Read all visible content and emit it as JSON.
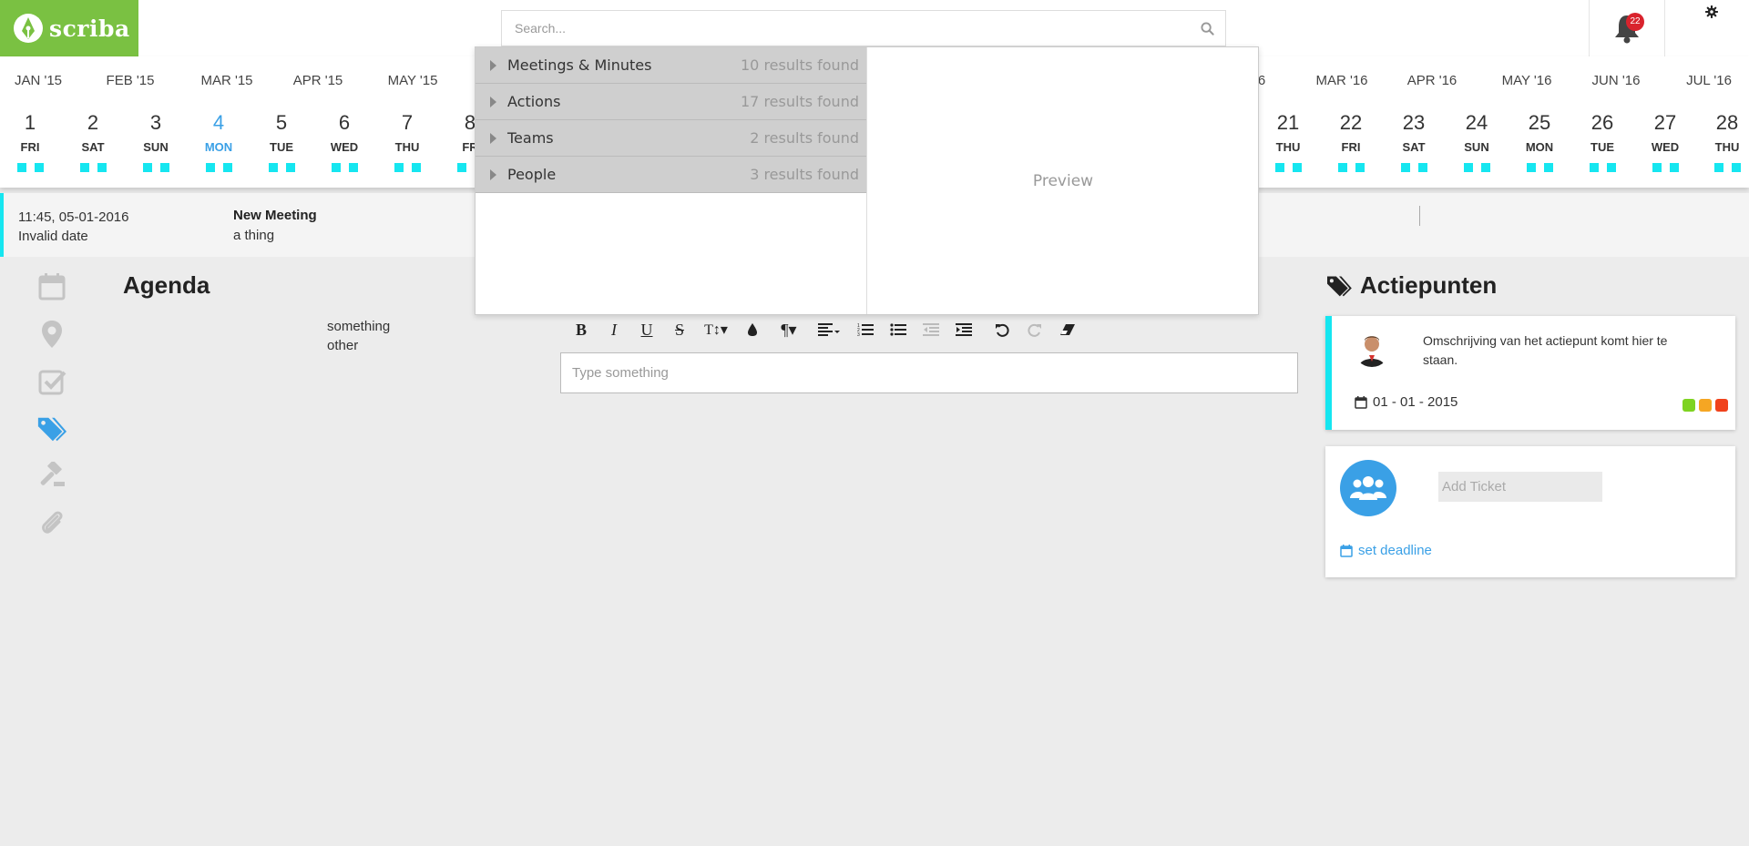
{
  "app": {
    "name": "scriba",
    "notification_count": "22"
  },
  "search": {
    "placeholder": "Search..."
  },
  "timeline": {
    "months": [
      "JAN '15",
      "FEB '15",
      "MAR '15",
      "APR '15",
      "MAY '15",
      "MAR '16",
      "APR '16",
      "MAY '16",
      "JUN '16",
      "JUL '16"
    ],
    "months_partial": [
      "6"
    ],
    "days_left": [
      {
        "num": "1",
        "wd": "FRI"
      },
      {
        "num": "2",
        "wd": "SAT"
      },
      {
        "num": "3",
        "wd": "SUN"
      },
      {
        "num": "4",
        "wd": "MON",
        "active": true
      },
      {
        "num": "5",
        "wd": "TUE"
      },
      {
        "num": "6",
        "wd": "WED"
      },
      {
        "num": "7",
        "wd": "THU"
      },
      {
        "num": "8",
        "wd": "FR"
      }
    ],
    "days_right": [
      {
        "num": "21",
        "wd": "THU"
      },
      {
        "num": "22",
        "wd": "FRI"
      },
      {
        "num": "23",
        "wd": "SAT"
      },
      {
        "num": "24",
        "wd": "SUN"
      },
      {
        "num": "25",
        "wd": "MON"
      },
      {
        "num": "26",
        "wd": "TUE"
      },
      {
        "num": "27",
        "wd": "WED"
      },
      {
        "num": "28",
        "wd": "THU"
      }
    ],
    "accent_color": "#16e6f0",
    "active_color": "#3aa0e6"
  },
  "meeting": {
    "datetime": "11:45, 05-01-2016",
    "date_status": "Invalid date",
    "title": "New Meeting",
    "subtitle": "a thing"
  },
  "sidebar": {
    "icons": [
      "calendar-icon",
      "map-marker-icon",
      "check-square-icon",
      "tags-icon",
      "gavel-icon",
      "paperclip-icon"
    ],
    "active": "tags-icon"
  },
  "agenda": {
    "heading": "Agenda",
    "items": [
      "something",
      "other"
    ]
  },
  "editor": {
    "placeholder": "Type something",
    "toolbar": [
      "bold",
      "italic",
      "underline",
      "strikethrough",
      "font-size",
      "color",
      "paragraph",
      "align",
      "ordered-list",
      "unordered-list",
      "outdent",
      "indent",
      "undo",
      "redo",
      "eraser"
    ]
  },
  "actions": {
    "heading": "Actiepunten",
    "card": {
      "description": "Omschrijving van het actiepunt komt hier te staan.",
      "date": "01 - 01 - 2015",
      "priority_colors": [
        "#7ed321",
        "#f5a623",
        "#f0421c"
      ]
    },
    "new_ticket": {
      "placeholder": "Add Ticket",
      "deadline_label": "set deadline"
    }
  },
  "search_dropdown": {
    "results": [
      {
        "label": "Meetings & Minutes",
        "count": "10 results found"
      },
      {
        "label": "Actions",
        "count": "17 results found"
      },
      {
        "label": "Teams",
        "count": "2 results found"
      },
      {
        "label": "People",
        "count": "3 results found"
      }
    ],
    "preview_label": "Preview"
  }
}
